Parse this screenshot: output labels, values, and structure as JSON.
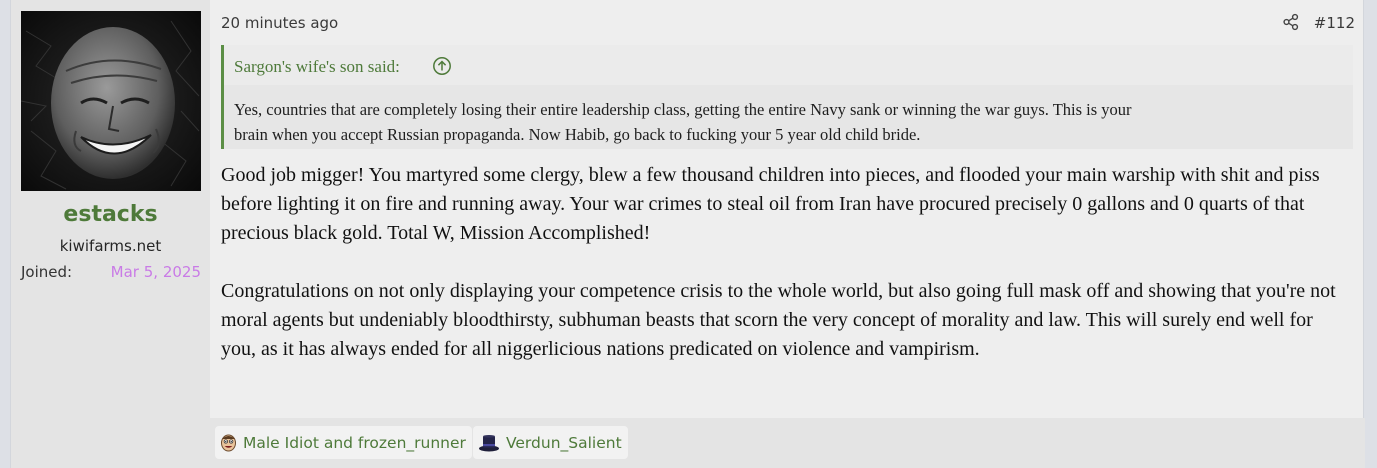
{
  "user": {
    "avatar_icon": "smiling-wojak-avatar",
    "name": "estacks",
    "title": "kiwifarms.net",
    "joined_label": "Joined:",
    "joined_date": "Mar 5, 2025"
  },
  "post": {
    "timestamp": "20 minutes ago",
    "share_icon": "share-icon",
    "number": "#112",
    "quote": {
      "author": "Sargon's wife's son said:",
      "jump_icon": "arrow-up-circle-icon",
      "body_line1": "Yes, countries that are completely losing their entire leadership class, getting the entire Navy sank or winning the war guys. This is your",
      "body_line2": "brain when you accept Russian propaganda. Now Habib, go back to fucking your 5 year old child bride."
    },
    "message": {
      "p1": "Good job migger! You martyred some clergy, blew a few thousand children into pieces, and flooded your main warship with shit and piss before lighting it on fire and running away. Your war crimes to steal oil from Iran have procured precisely 0 gallons and 0 quarts of that precious black gold. Total W, Mission Accomplished!",
      "p2": "Congratulations on not only displaying your competence crisis to the whole world, but also going full mask off and showing that you're not moral agents but undeniably bloodthirsty, subhuman beasts that scorn the very concept of morality and law. This will surely end well for you, as it has always ended for all niggerlicious nations predicated on violence and vampirism."
    },
    "reactions": [
      {
        "icon": "idiot-face-icon",
        "label": "Male Idiot and frozen_runner"
      },
      {
        "icon": "top-hat-icon",
        "label": "Verdun_Salient"
      }
    ]
  },
  "colors": {
    "accent_green": "#4e7a3a",
    "joined_date": "#c97be6",
    "post_bg": "#eeeeee",
    "sidebar_bg": "#e4e4e4"
  }
}
